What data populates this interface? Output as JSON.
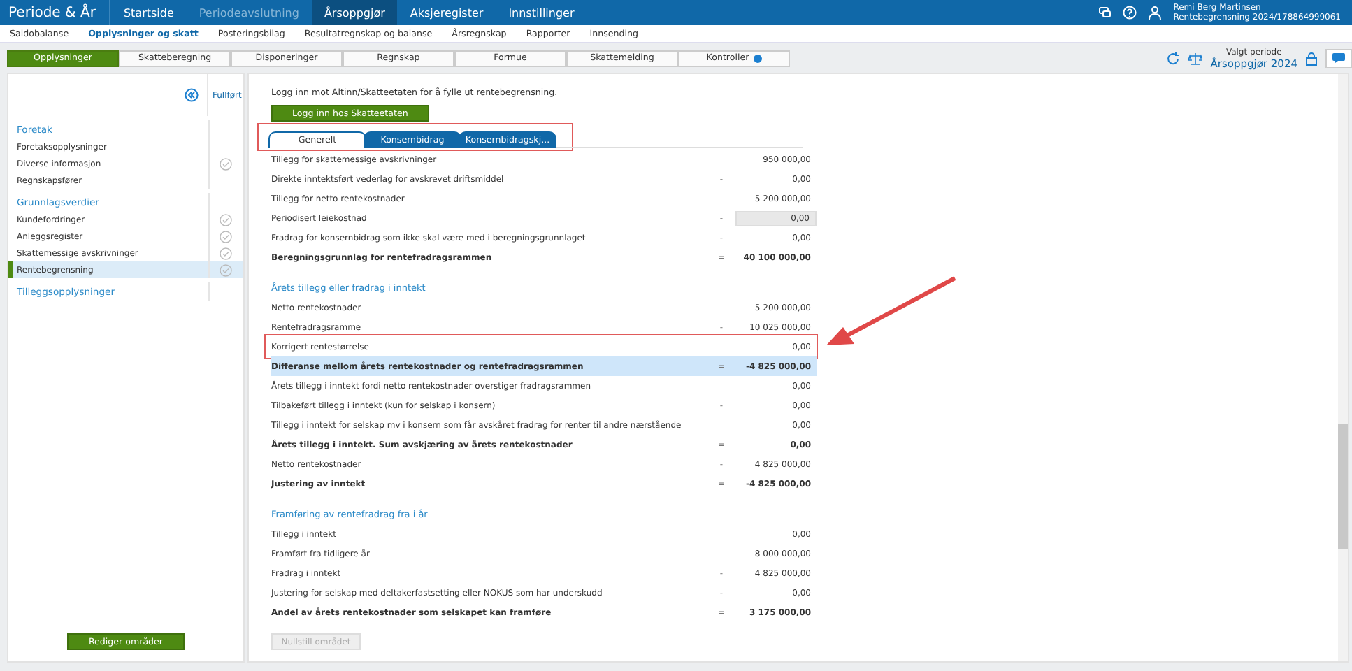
{
  "top_nav": {
    "brand": "Periode & År",
    "items": [
      {
        "label": "Startside",
        "selected": false,
        "disabled": false
      },
      {
        "label": "Periodeavslutning",
        "selected": false,
        "disabled": true
      },
      {
        "label": "Årsoppgjør",
        "selected": true,
        "disabled": false
      },
      {
        "label": "Aksjeregister",
        "selected": false,
        "disabled": false
      },
      {
        "label": "Innstillinger",
        "selected": false,
        "disabled": false
      }
    ],
    "user": {
      "name": "Remi Berg Martinsen",
      "context": "Rentebegrensning 2024/178864999061"
    }
  },
  "sub_nav": [
    {
      "label": "Saldobalanse",
      "selected": false
    },
    {
      "label": "Opplysninger og skatt",
      "selected": true
    },
    {
      "label": "Posteringsbilag",
      "selected": false
    },
    {
      "label": "Resultatregnskap og balanse",
      "selected": false
    },
    {
      "label": "Årsregnskap",
      "selected": false
    },
    {
      "label": "Rapporter",
      "selected": false
    },
    {
      "label": "Innsending",
      "selected": false
    }
  ],
  "steps": [
    {
      "label": "Opplysninger",
      "selected": true,
      "info": false
    },
    {
      "label": "Skatteberegning",
      "selected": false,
      "info": false
    },
    {
      "label": "Disponeringer",
      "selected": false,
      "info": false
    },
    {
      "label": "Regnskap",
      "selected": false,
      "info": false
    },
    {
      "label": "Formue",
      "selected": false,
      "info": false
    },
    {
      "label": "Skattemelding",
      "selected": false,
      "info": false
    },
    {
      "label": "Kontroller",
      "selected": false,
      "info": true
    }
  ],
  "period": {
    "label": "Valgt periode",
    "value": "Årsoppgjør 2024"
  },
  "sidebar": {
    "done_header": "Fullført",
    "groups": [
      {
        "title": "Foretak",
        "items": [
          {
            "label": "Foretaksopplysninger",
            "done": false,
            "selected": false
          },
          {
            "label": "Diverse informasjon",
            "done": true,
            "selected": false
          },
          {
            "label": "Regnskapsfører",
            "done": false,
            "selected": false
          }
        ]
      },
      {
        "title": "Grunnlagsverdier",
        "items": [
          {
            "label": "Kundefordringer",
            "done": true,
            "selected": false
          },
          {
            "label": "Anleggsregister",
            "done": true,
            "selected": false
          },
          {
            "label": "Skattemessige avskrivninger",
            "done": true,
            "selected": false
          },
          {
            "label": "Rentebegrensning",
            "done": true,
            "selected": true
          }
        ]
      },
      {
        "title": "Tilleggsopplysninger"
      }
    ],
    "edit_button": "Rediger områder"
  },
  "main": {
    "login_text": "Logg inn mot Altinn/Skatteetaten for å fylle ut rentebegrensning.",
    "login_button": "Logg inn hos Skatteetaten",
    "tabs": [
      {
        "label": "Generelt",
        "selected": true
      },
      {
        "label": "Konsernbidrag",
        "selected": false
      },
      {
        "label": "Konsernbidragskj...",
        "selected": false
      }
    ],
    "sections": [
      {
        "rows": [
          {
            "label": "Tillegg for skattemessige avskrivninger",
            "op": "",
            "value": "950 000,00",
            "bold": false,
            "highlighted": false,
            "editable": false
          },
          {
            "label": "Direkte inntektsført vederlag for avskrevet driftsmiddel",
            "op": "-",
            "value": "0,00",
            "bold": false,
            "highlighted": false,
            "editable": false
          },
          {
            "label": "Tillegg for netto rentekostnader",
            "op": "",
            "value": "5 200 000,00",
            "bold": false,
            "highlighted": false,
            "editable": false
          },
          {
            "label": "Periodisert leiekostnad",
            "op": "-",
            "value": "0,00",
            "bold": false,
            "highlighted": false,
            "editable": true
          },
          {
            "label": "Fradrag for konsernbidrag som ikke skal være med i beregningsgrunnlaget",
            "op": "-",
            "value": "0,00",
            "bold": false,
            "highlighted": false,
            "editable": false
          },
          {
            "label": "Beregningsgrunnlag for rentefradragsrammen",
            "op": "=",
            "value": "40 100 000,00",
            "bold": true,
            "highlighted": false,
            "editable": false
          }
        ]
      },
      {
        "heading": "Årets tillegg eller fradrag i inntekt",
        "rows": [
          {
            "label": "Netto rentekostnader",
            "op": "",
            "value": "5 200 000,00",
            "bold": false,
            "highlighted": false,
            "editable": false
          },
          {
            "label": "Rentefradragsramme",
            "op": "-",
            "value": "10 025 000,00",
            "bold": false,
            "highlighted": false,
            "editable": false
          },
          {
            "label": "Korrigert rentestørrelse",
            "op": "",
            "value": "0,00",
            "bold": false,
            "highlighted": false,
            "editable": false,
            "annotated": true
          },
          {
            "label": "Differanse mellom årets rentekostnader og rentefradragsrammen",
            "op": "=",
            "value": "-4 825 000,00",
            "bold": true,
            "highlighted": true,
            "editable": false
          },
          {
            "label": "Årets tillegg i inntekt fordi netto rentekostnader overstiger fradragsrammen",
            "op": "",
            "value": "0,00",
            "bold": false,
            "highlighted": false,
            "editable": false
          },
          {
            "label": "Tilbakeført tillegg i inntekt (kun for selskap i konsern)",
            "op": "-",
            "value": "0,00",
            "bold": false,
            "highlighted": false,
            "editable": false
          },
          {
            "label": "Tillegg i inntekt for selskap mv i konsern som får avskåret fradrag for renter til andre nærstående",
            "op": "",
            "value": "0,00",
            "bold": false,
            "highlighted": false,
            "editable": false
          },
          {
            "label": "Årets tillegg i inntekt. Sum avskjæring av årets rentekostnader",
            "op": "=",
            "value": "0,00",
            "bold": true,
            "highlighted": false,
            "editable": false
          },
          {
            "label": "Netto rentekostnader",
            "op": "-",
            "value": "4 825 000,00",
            "bold": false,
            "highlighted": false,
            "editable": false
          },
          {
            "label": "Justering av inntekt",
            "op": "=",
            "value": "-4 825 000,00",
            "bold": true,
            "highlighted": false,
            "editable": false
          }
        ]
      },
      {
        "heading": "Framføring av rentefradrag fra i år",
        "rows": [
          {
            "label": "Tillegg i inntekt",
            "op": "",
            "value": "0,00",
            "bold": false,
            "highlighted": false,
            "editable": false
          },
          {
            "label": "Framført fra tidligere år",
            "op": "",
            "value": "8 000 000,00",
            "bold": false,
            "highlighted": false,
            "editable": false
          },
          {
            "label": "Fradrag i inntekt",
            "op": "-",
            "value": "4 825 000,00",
            "bold": false,
            "highlighted": false,
            "editable": false
          },
          {
            "label": "Justering for selskap med deltakerfastsetting eller NOKUS som har underskudd",
            "op": "-",
            "value": "0,00",
            "bold": false,
            "highlighted": false,
            "editable": false
          },
          {
            "label": "Andel av årets rentekostnader som selskapet kan framføre",
            "op": "=",
            "value": "3 175 000,00",
            "bold": true,
            "highlighted": false,
            "editable": false
          }
        ]
      }
    ],
    "reset_button": {
      "label": "Nullstill området",
      "disabled": true
    }
  }
}
